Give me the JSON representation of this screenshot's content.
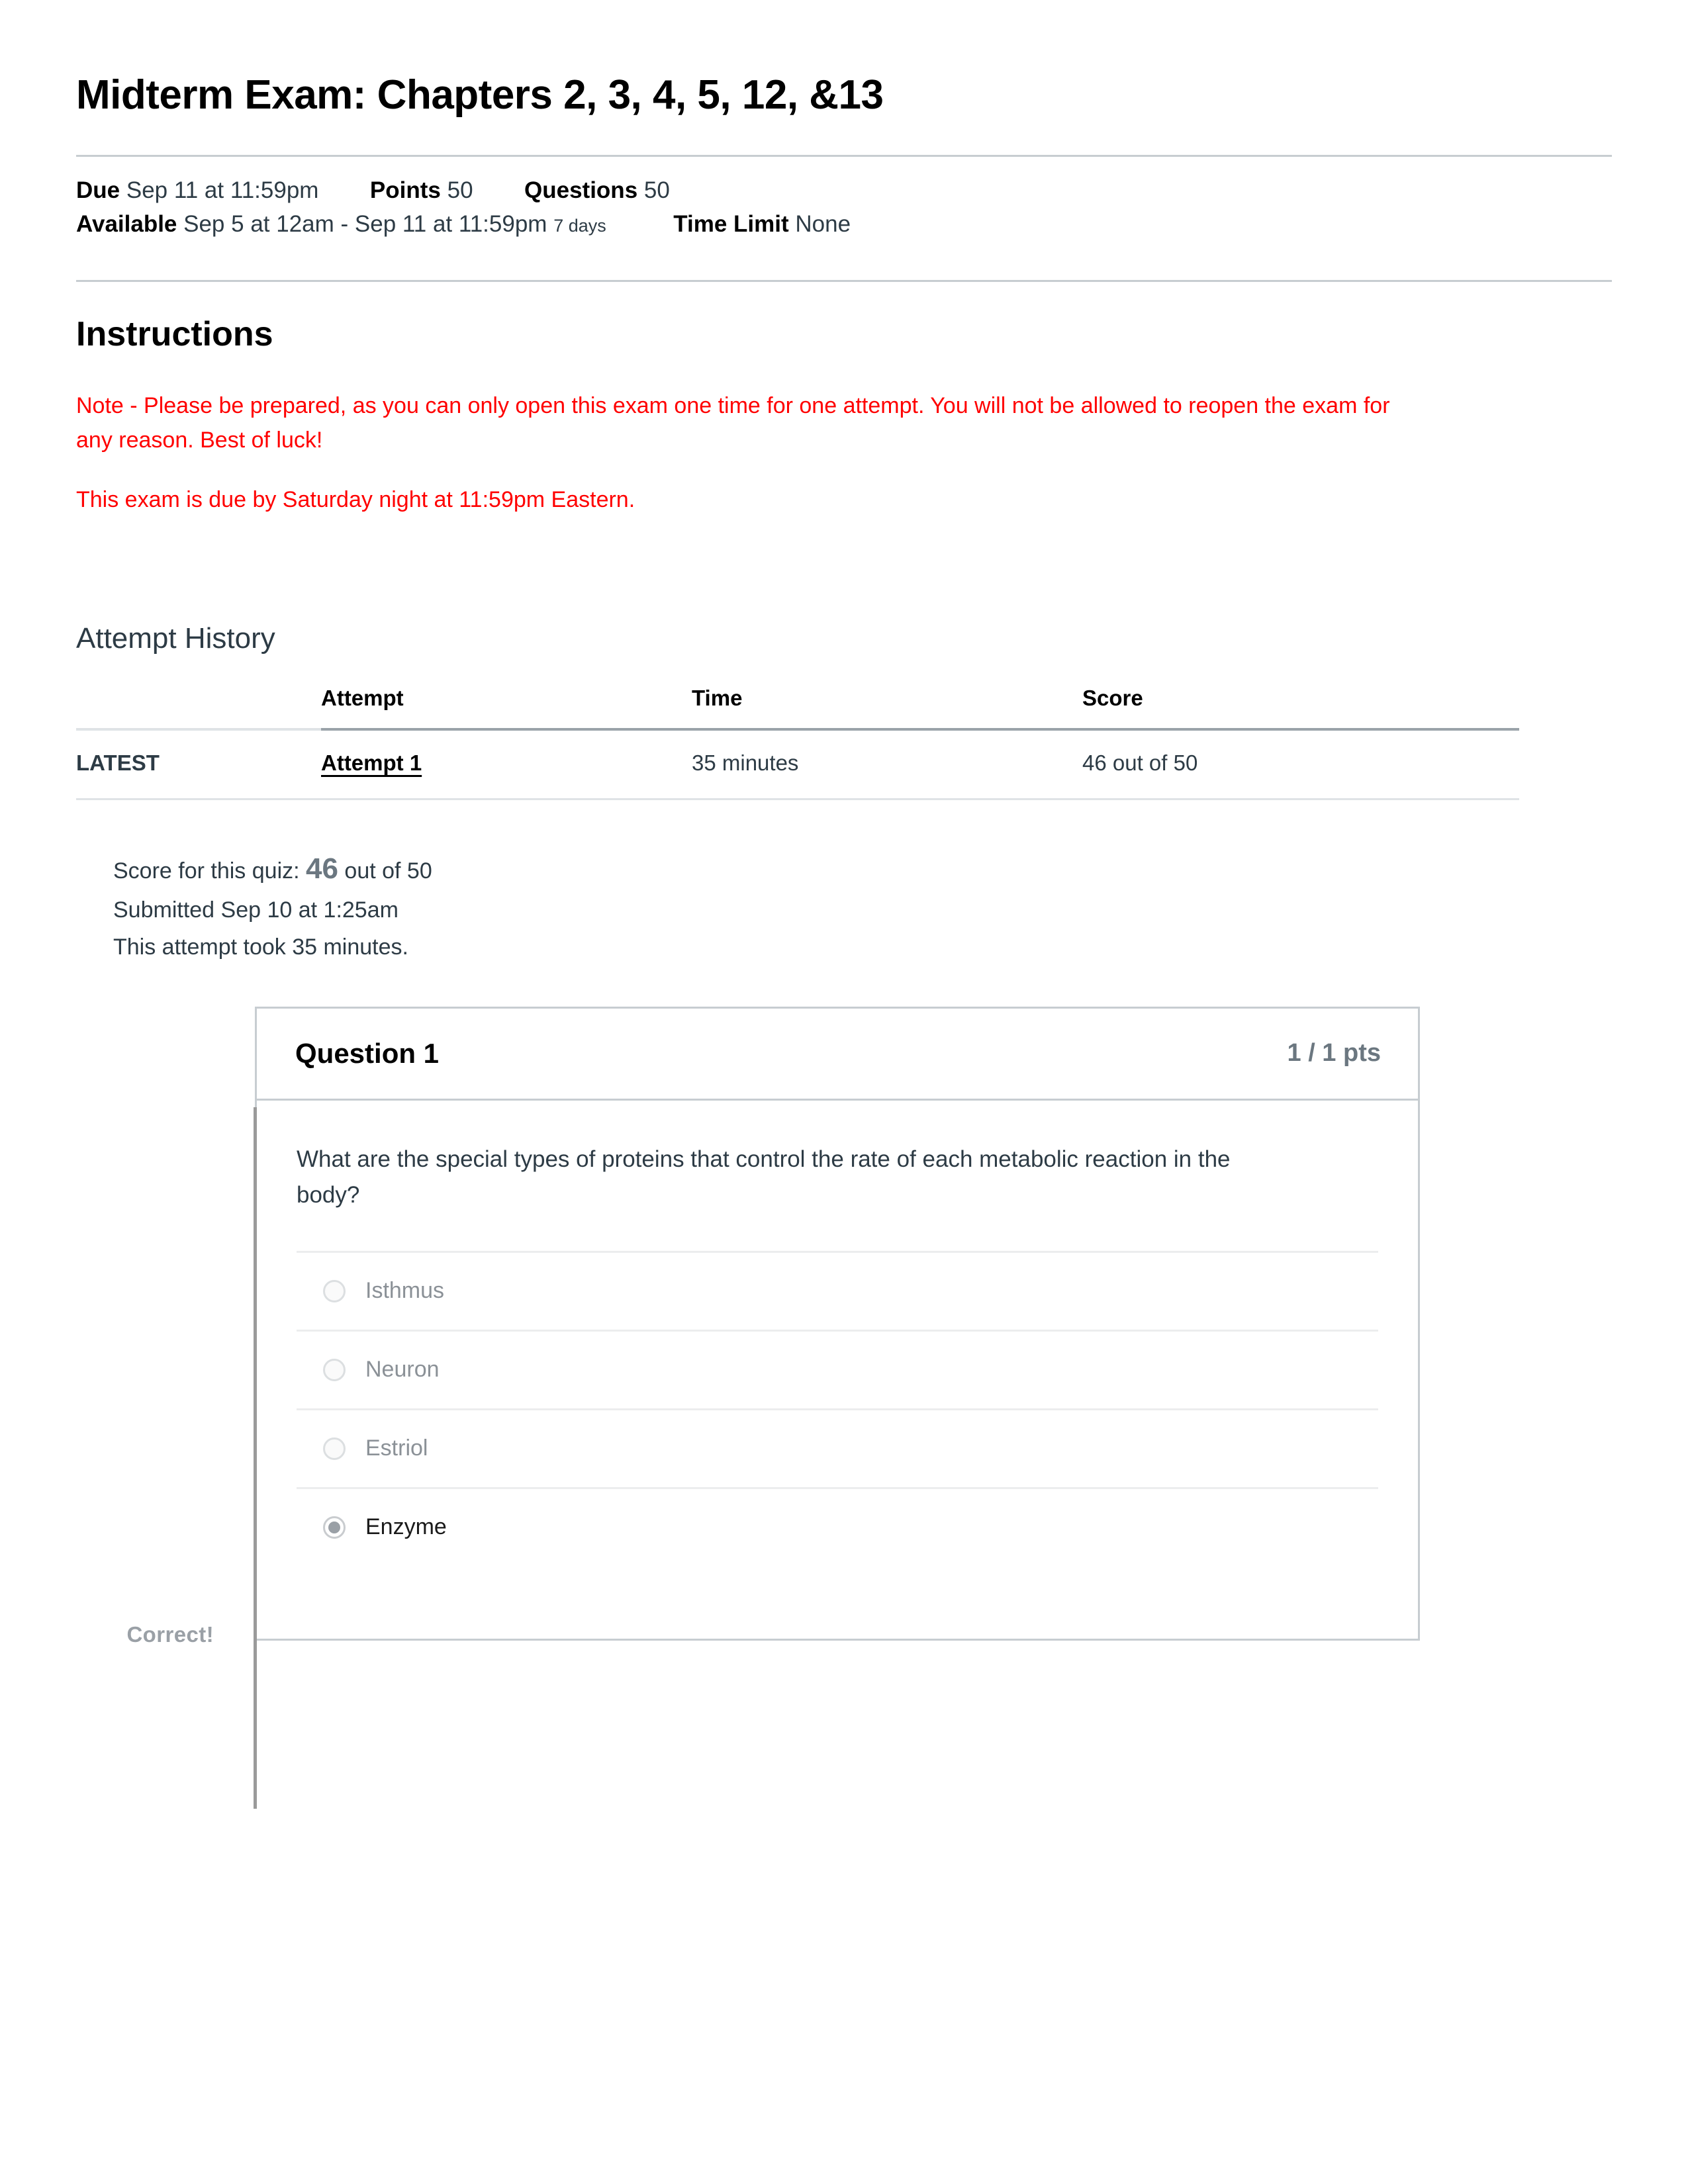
{
  "quiz": {
    "title": "Midterm Exam: Chapters 2, 3, 4, 5, 12, &13",
    "meta": {
      "due_label": "Due",
      "due_value": "Sep 11 at 11:59pm",
      "points_label": "Points",
      "points_value": "50",
      "questions_label": "Questions",
      "questions_value": "50",
      "available_label": "Available",
      "available_value": "Sep 5 at 12am - Sep 11 at 11:59pm",
      "available_duration": "7 days",
      "time_limit_label": "Time Limit",
      "time_limit_value": "None"
    }
  },
  "instructions": {
    "heading": "Instructions",
    "paragraph_1": "Note - Please be prepared, as you can only open this exam one time for one attempt.  You will not be allowed to reopen the exam for any reason. Best of luck!",
    "paragraph_2": "This exam is due by Saturday night at 11:59pm Eastern.",
    "color": "#ff0000"
  },
  "attempt_history": {
    "heading": "Attempt History",
    "columns": [
      "",
      "Attempt",
      "Time",
      "Score"
    ],
    "rows": [
      {
        "flag": "LATEST",
        "attempt": "Attempt 1 ",
        "time": "35 minutes",
        "score": "46 out of 50"
      }
    ]
  },
  "score_summary": {
    "score_prefix": "Score for this quiz:",
    "score_value": "46",
    "score_suffix": "out of 50",
    "submitted": "Submitted Sep 10 at 1:25am",
    "duration": "This attempt took 35 minutes."
  },
  "question": {
    "label": "Question 1",
    "points": "1 / 1 pts",
    "text": "What are the special types of proteins that control the rate of each metabolic reaction in the body?",
    "result_flag": "Correct!",
    "answers": [
      {
        "label": "Isthmus",
        "selected": false
      },
      {
        "label": "Neuron",
        "selected": false
      },
      {
        "label": "Estriol",
        "selected": false
      },
      {
        "label": "Enzyme",
        "selected": true
      }
    ]
  }
}
